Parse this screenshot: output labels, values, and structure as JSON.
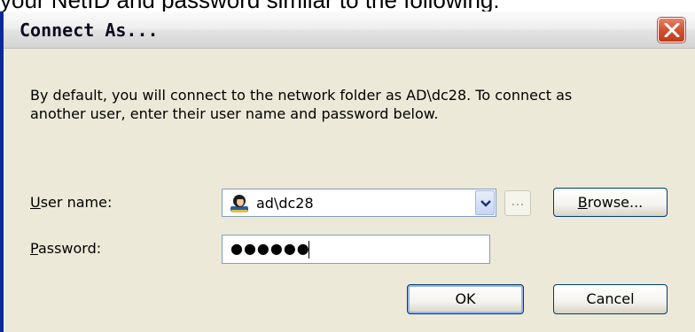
{
  "caption": "your NetID and password similar to the following:",
  "dialog": {
    "title": "Connect As...",
    "description": "By default, you will connect to the network folder as AD\\dc28. To connect as another user, enter their user name and password below.",
    "username_label_accel": "U",
    "username_label_rest": "ser name:",
    "username_value": "ad\\dc28",
    "ellipsis_label": "...",
    "browse_label_accel": "B",
    "browse_label_rest": "rowse...",
    "password_label_accel": "P",
    "password_label_rest": "assword:",
    "password_masked": "●●●●●●",
    "ok_label": "OK",
    "cancel_label": "Cancel"
  },
  "colors": {
    "window_bg": "#ece9d8",
    "close_red": "#d3512f",
    "frame_blue": "#0a2a9a"
  }
}
